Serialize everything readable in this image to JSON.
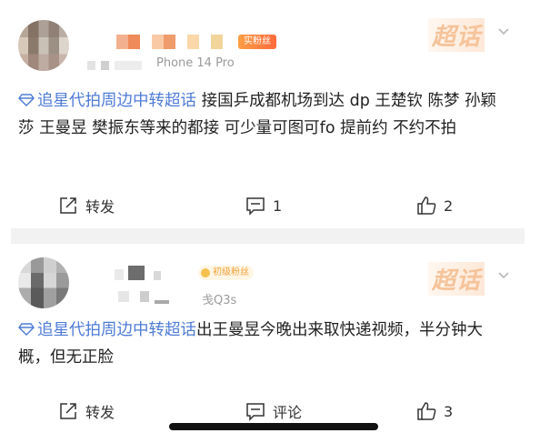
{
  "posts": [
    {
      "badge": "实粉丝",
      "source": "Phone 14 Pro",
      "supertopic_label": "超话",
      "topic": "追星代拍周边中转超话",
      "text": " 接国乒成都机场到达 dp 王楚钦 陈梦 孙颖莎 王曼昱 樊振东等来的都接 可少量可图可fo 提前约 不约不拍",
      "repost_label": "转发",
      "comment_label": "1",
      "like_label": "2"
    },
    {
      "badge": "初级粉丝",
      "source": "戋Q3s",
      "supertopic_label": "超话",
      "topic": "追星代拍周边中转超话",
      "text": "出王曼昱今晚出来取快递视频，半分钟大概，但无正脸",
      "repost_label": "转发",
      "comment_label": "评论",
      "like_label": "3"
    }
  ],
  "colors": {
    "topic_blue": "#4e7bd6",
    "supertopic_orange": "#f6c39a",
    "badge_orange": "#ff7a3d"
  },
  "icons": [
    "topic-diamond-icon",
    "chevron-down-icon",
    "repost-icon",
    "comment-icon",
    "like-icon"
  ]
}
